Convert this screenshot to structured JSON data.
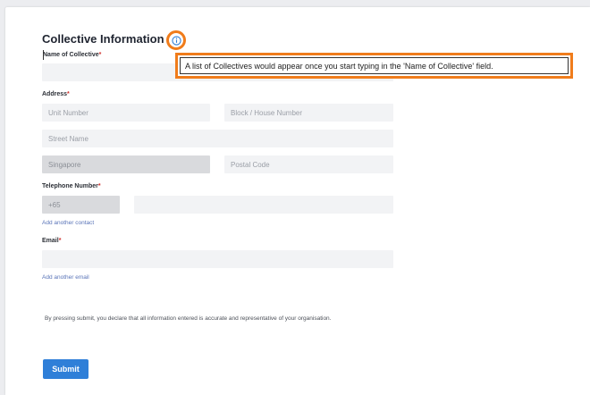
{
  "form": {
    "title": "Collective Information",
    "name_label": "Name of Collective",
    "required_mark": "*",
    "name_value": "",
    "address_label": "Address",
    "unit_placeholder": "Unit Number",
    "block_placeholder": "Block / House Number",
    "street_placeholder": "Street Name",
    "country_value": "Singapore",
    "postal_placeholder": "Postal Code",
    "phone_label": "Telephone Number",
    "country_code": "+65",
    "phone_value": "",
    "add_contact": "Add another contact",
    "email_label": "Email",
    "email_value": "",
    "add_email": "Add another email",
    "declaration": "By pressing submit, you declare that all information entered is accurate and representative of your organisation.",
    "submit_label": "Submit"
  },
  "tooltip": {
    "text": "A list of Collectives would appear once you start typing in the 'Name of Collective' field."
  },
  "icons": {
    "info": "info-icon"
  },
  "colors": {
    "accent": "#2f7fd8",
    "highlight": "#f07c1b",
    "required": "#d0312d",
    "link": "#5a74b8"
  }
}
